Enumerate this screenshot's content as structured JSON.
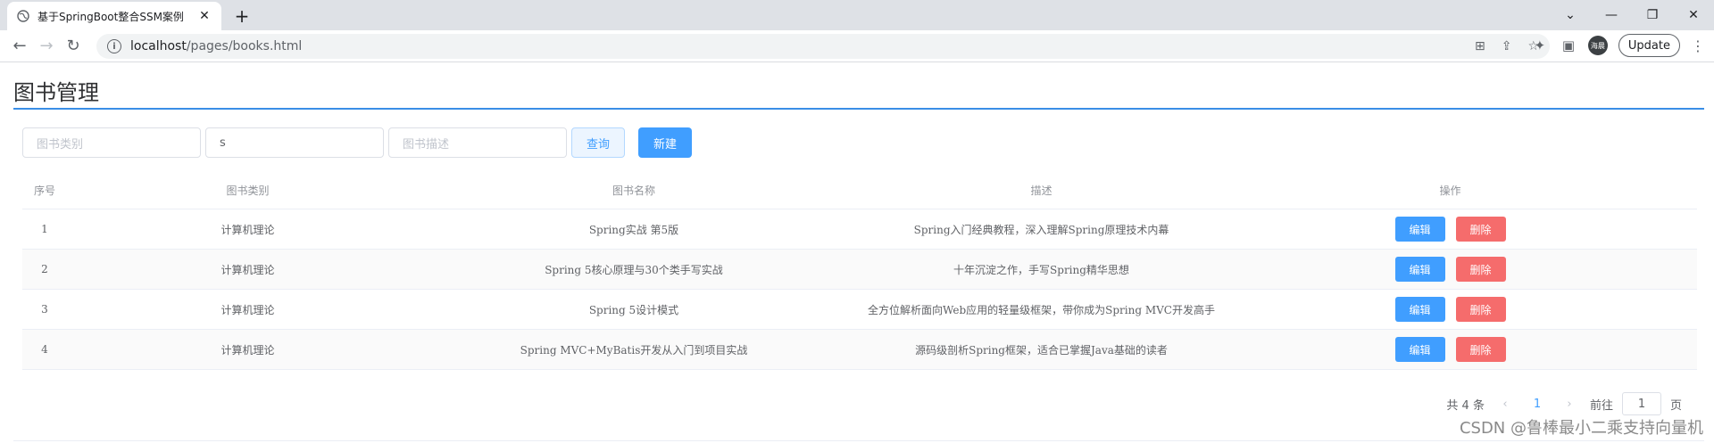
{
  "browser": {
    "tab_title": "基于SpringBoot整合SSM案例",
    "tab_close": "✕",
    "new_tab": "+",
    "url_host": "localhost",
    "url_path": "/pages/books.html",
    "update_label": "Update",
    "avatar_text": "海晨"
  },
  "page": {
    "title": "图书管理"
  },
  "filters": {
    "type_placeholder": "图书类别",
    "name_value": "s",
    "desc_placeholder": "图书描述",
    "query_label": "查询",
    "new_label": "新建"
  },
  "table": {
    "headers": [
      "序号",
      "图书类别",
      "图书名称",
      "描述",
      "操作"
    ],
    "edit_label": "编辑",
    "delete_label": "删除",
    "rows": [
      {
        "index": "1",
        "type": "计算机理论",
        "name": "Spring实战 第5版",
        "desc": "Spring入门经典教程，深入理解Spring原理技术内幕"
      },
      {
        "index": "2",
        "type": "计算机理论",
        "name": "Spring 5核心原理与30个类手写实战",
        "desc": "十年沉淀之作，手写Spring精华思想"
      },
      {
        "index": "3",
        "type": "计算机理论",
        "name": "Spring 5设计模式",
        "desc": "全方位解析面向Web应用的轻量级框架，带你成为Spring MVC开发高手"
      },
      {
        "index": "4",
        "type": "计算机理论",
        "name": "Spring MVC+MyBatis开发从入门到项目实战",
        "desc": "源码级剖析Spring框架，适合已掌握Java基础的读者"
      }
    ]
  },
  "pagination": {
    "total_text": "共 4 条",
    "current_page": "1",
    "goto_label": "前往",
    "goto_value": "1",
    "page_suffix": "页"
  },
  "watermark": "CSDN @鲁棒最小二乘支持向量机"
}
